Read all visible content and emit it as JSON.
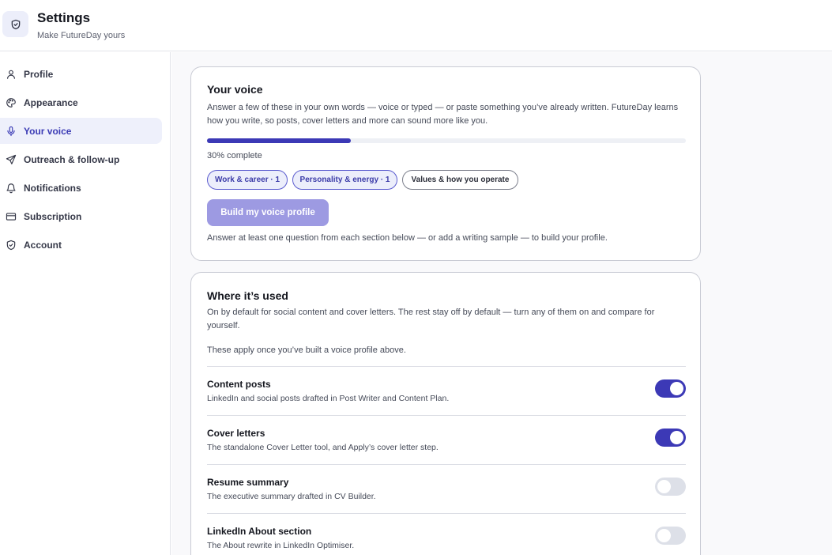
{
  "header": {
    "title": "Settings",
    "subtitle": "Make FutureDay yours",
    "icon": "shield-icon"
  },
  "sidebar": {
    "items": [
      {
        "label": "Profile",
        "icon": "user-icon",
        "active": false
      },
      {
        "label": "Appearance",
        "icon": "palette-icon",
        "active": false
      },
      {
        "label": "Your voice",
        "icon": "microphone-icon",
        "active": true
      },
      {
        "label": "Outreach & follow-up",
        "icon": "send-icon",
        "active": false
      },
      {
        "label": "Notifications",
        "icon": "bell-icon",
        "active": false
      },
      {
        "label": "Subscription",
        "icon": "credit-card-icon",
        "active": false
      },
      {
        "label": "Account",
        "icon": "shield-icon",
        "active": false
      }
    ]
  },
  "voice": {
    "title": "Your voice",
    "description": "Answer a few of these in your own words — voice or typed — or paste something you’ve already written. FutureDay learns how you write, so posts, cover letters and more can sound more like you.",
    "progress_percent": 30,
    "progress_label": "30% complete",
    "chips": [
      {
        "label": "Work & career · 1",
        "selected": true
      },
      {
        "label": "Personality & energy · 1",
        "selected": true
      },
      {
        "label": "Values & how you operate",
        "selected": false
      }
    ],
    "build_button": "Build my voice profile",
    "hint": "Answer at least one question from each section below — or add a writing sample — to build your profile."
  },
  "usage": {
    "title": "Where it’s used",
    "description": "On by default for social content and cover letters. The rest stay off by default — turn any of them on and compare for yourself.",
    "note": "These apply once you’ve built a voice profile above.",
    "rows": [
      {
        "title": "Content posts",
        "desc": "LinkedIn and social posts drafted in Post Writer and Content Plan.",
        "enabled": true
      },
      {
        "title": "Cover letters",
        "desc": "The standalone Cover Letter tool, and Apply’s cover letter step.",
        "enabled": true
      },
      {
        "title": "Resume summary",
        "desc": "The executive summary drafted in CV Builder.",
        "enabled": false
      },
      {
        "title": "LinkedIn About section",
        "desc": "The About rewrite in LinkedIn Optimiser.",
        "enabled": false
      }
    ]
  },
  "colors": {
    "accent": "#3c39b6",
    "accent_light": "#eef0fb",
    "button_disabled": "#9d9ae2"
  }
}
